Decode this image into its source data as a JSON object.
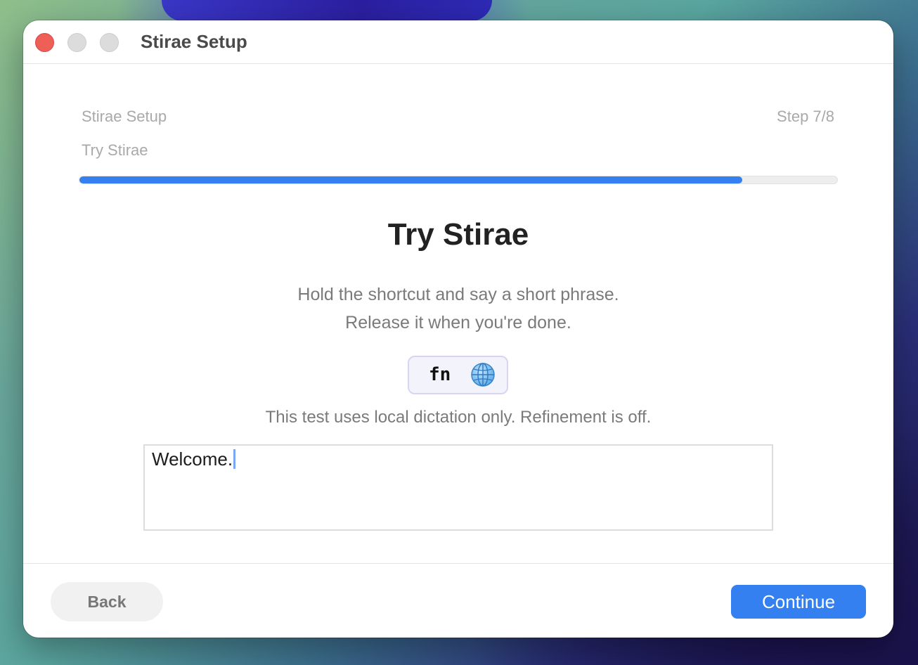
{
  "window": {
    "title": "Stirae Setup"
  },
  "header": {
    "setup_title": "Stirae Setup",
    "step_label": "Step 7/8",
    "current_step": "Try Stirae",
    "progress_fraction": 0.875
  },
  "main": {
    "heading": "Try Stirae",
    "instruction_line1": "Hold the shortcut and say a short phrase.",
    "instruction_line2": "Release it when you're done.",
    "shortcut": {
      "key_label": "fn",
      "icon": "globe-icon"
    },
    "note": "This test uses local dictation only. Refinement is off.",
    "test_area": {
      "value": "Welcome."
    }
  },
  "footer": {
    "back_label": "Back",
    "continue_label": "Continue"
  },
  "colors": {
    "accent": "#3580f0",
    "close_button": "#ee5f58"
  }
}
